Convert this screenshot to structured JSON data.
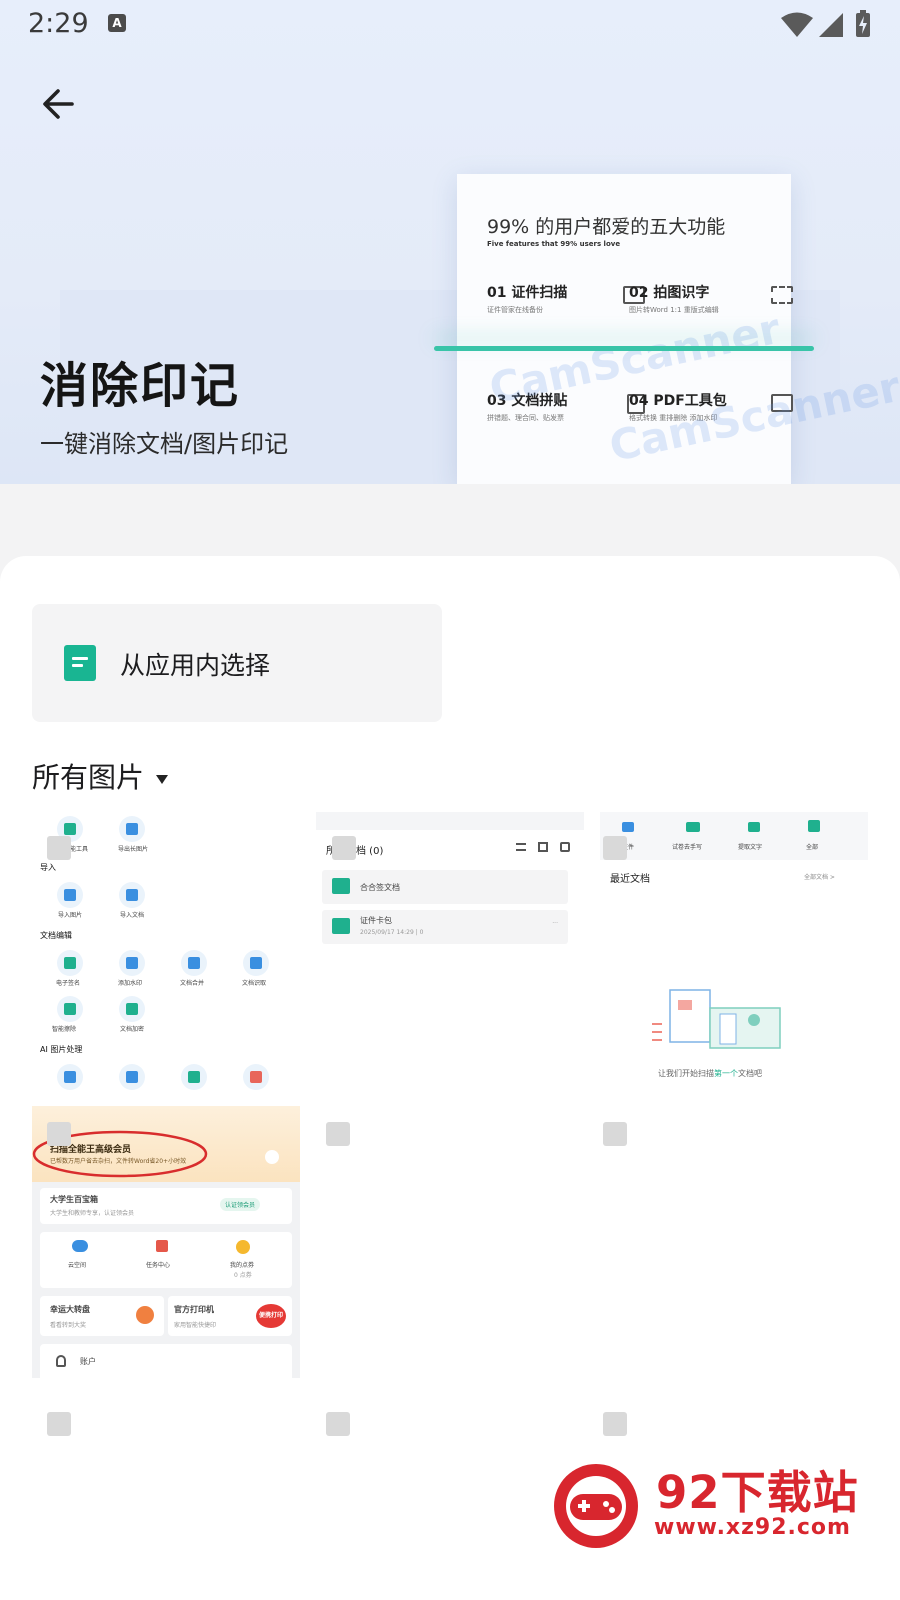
{
  "status_bar": {
    "time": "2:29",
    "a_label": "A"
  },
  "banner": {
    "title": "消除印记",
    "subtitle": "一键消除文档/图片印记",
    "card_title": "99% 的用户都爱的五大功能",
    "card_subtitle": "Five features that 99% users love",
    "features": [
      {
        "title": "01 证件扫描",
        "sub": "证件管家在线备份"
      },
      {
        "title": "02 拍图识字",
        "sub": "图片转Word 1:1 重版式编辑"
      },
      {
        "title": "03 文档拼贴",
        "sub": "拼错题、理合同、贴发票"
      },
      {
        "title": "04 PDF工具包",
        "sub": "格式转换 重排删除 添加水印"
      }
    ],
    "watermark": "CamScanner"
  },
  "sheet": {
    "pick_label": "从应用内选择",
    "album_label": "所有图片"
  },
  "thumbs": {
    "t1": {
      "top_labels": [
        "全部智能工具",
        "导出长图片"
      ],
      "sec_import": "导入",
      "import_labels": [
        "导入图片",
        "导入文档"
      ],
      "sec_edit": "文档编辑",
      "edit_labels": [
        "电子签名",
        "添加水印",
        "文档合并",
        "文档识取",
        "智能擦除",
        "文档加密"
      ],
      "sec_ai": "AI 图片处理"
    },
    "t2": {
      "header": "所有文档 (0)",
      "folders": [
        {
          "name": "合合签文档",
          "meta": ""
        },
        {
          "name": "证件卡包",
          "meta": "2025/09/17 14:29 | 0"
        }
      ]
    },
    "t3": {
      "tabs": [
        "扫描证件",
        "试卷去手写",
        "提取文字",
        "全部"
      ],
      "recent": "最近文档",
      "all_docs": "全部文档 >",
      "empty_prefix": "让我们开始扫描",
      "empty_highlight": "第一个",
      "empty_suffix": "文档吧"
    },
    "t4": {
      "vip_title": "扫描全能王高级会员",
      "vip_sub": "已帮数万用户省去杂扫，文件转Word省20+小时效",
      "student_title": "大学生百宝箱",
      "student_sub": "大学生和教师专享，认证领会员",
      "student_btn": "认证领会员",
      "grid": [
        "云空间",
        "任务中心",
        "我的点券"
      ],
      "points": "0 点券",
      "lucky_title": "幸运大转盘",
      "lucky_sub": "看看转到大奖",
      "print_title": "官方打印机",
      "print_sub": "家用智能快捷印",
      "print_badge": "便携打印",
      "account": "账户"
    }
  },
  "logo": {
    "text": "92下载站",
    "url": "www.xz92.com"
  }
}
